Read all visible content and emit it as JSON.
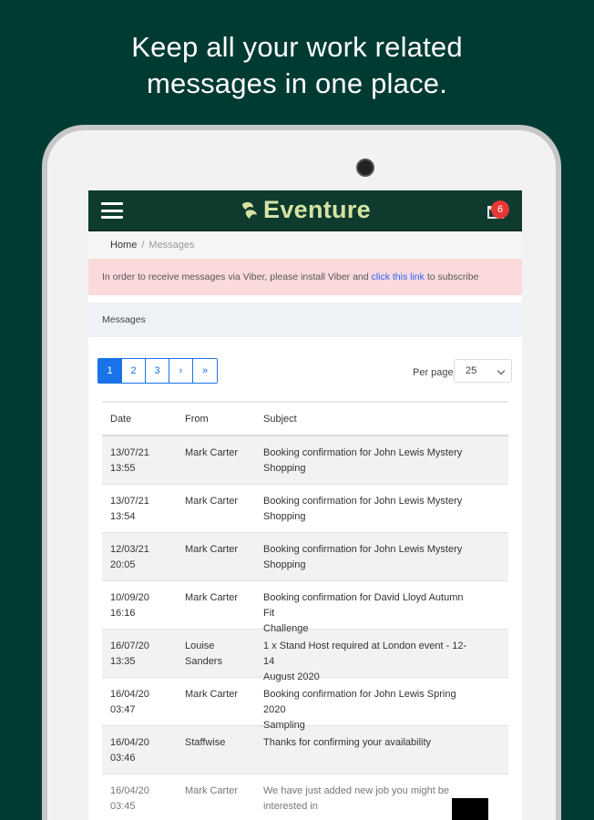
{
  "headline": {
    "line1": "Keep all your work related",
    "line2": "messages in one place."
  },
  "appbar": {
    "brand": "Eventure",
    "badge_count": "6",
    "brand_color": "#d6e3a4",
    "bar_color": "#0f3b2f"
  },
  "breadcrumb": {
    "home": "Home",
    "separator": "/",
    "current": "Messages"
  },
  "alert": {
    "prefix": "In order to receive messages via Viber, please install Viber and",
    "link": "click this link",
    "suffix": "to subscribe"
  },
  "section_title": "Messages",
  "pagination": {
    "pages": [
      "1",
      "2",
      "3",
      "›",
      "»"
    ],
    "active": "1"
  },
  "per_page": {
    "label": "Per page",
    "value": "25"
  },
  "table": {
    "headers": {
      "date": "Date",
      "from": "From",
      "subject": "Subject"
    },
    "rows": [
      {
        "date": "13/07/21",
        "time": "13:55",
        "from": "Mark Carter",
        "from2": "",
        "subject": "Booking confirmation for John Lewis Mystery",
        "subject2": "Shopping"
      },
      {
        "date": "13/07/21",
        "time": "13:54",
        "from": "Mark Carter",
        "from2": "",
        "subject": "Booking confirmation for John Lewis Mystery",
        "subject2": "Shopping"
      },
      {
        "date": "12/03/21",
        "time": "20:05",
        "from": "Mark Carter",
        "from2": "",
        "subject": "Booking confirmation for John Lewis Mystery",
        "subject2": "Shopping"
      },
      {
        "date": "10/09/20",
        "time": "16:16",
        "from": "Mark Carter",
        "from2": "",
        "subject": "Booking confirmation for David Lloyd Autumn Fit",
        "subject2": "Challenge"
      },
      {
        "date": "16/07/20",
        "time": "13:35",
        "from": "Louise",
        "from2": "Sanders",
        "subject": "1 x Stand Host required at London event - 12-14",
        "subject2": "August 2020"
      },
      {
        "date": "16/04/20",
        "time": "03:47",
        "from": "Mark Carter",
        "from2": "",
        "subject": "Booking confirmation for John Lewis Spring 2020",
        "subject2": "Sampling"
      },
      {
        "date": "16/04/20",
        "time": "03:46",
        "from": "Staffwise",
        "from2": "",
        "subject": "Thanks for confirming your availability",
        "subject2": ""
      },
      {
        "date": "16/04/20",
        "time": "03:45",
        "from": "Mark Carter",
        "from2": "",
        "subject": "We have just added new job you might be",
        "subject2": "interested in"
      }
    ]
  },
  "colors": {
    "background": "#003b33",
    "accent": "#1a73e8",
    "alert_bg": "#fbdadb",
    "badge": "#e53935"
  },
  "icons": {
    "menu": "hamburger-icon",
    "mail": "mail-icon",
    "brand": "eventure-logo-mark",
    "select": "chevron-down-icon"
  }
}
